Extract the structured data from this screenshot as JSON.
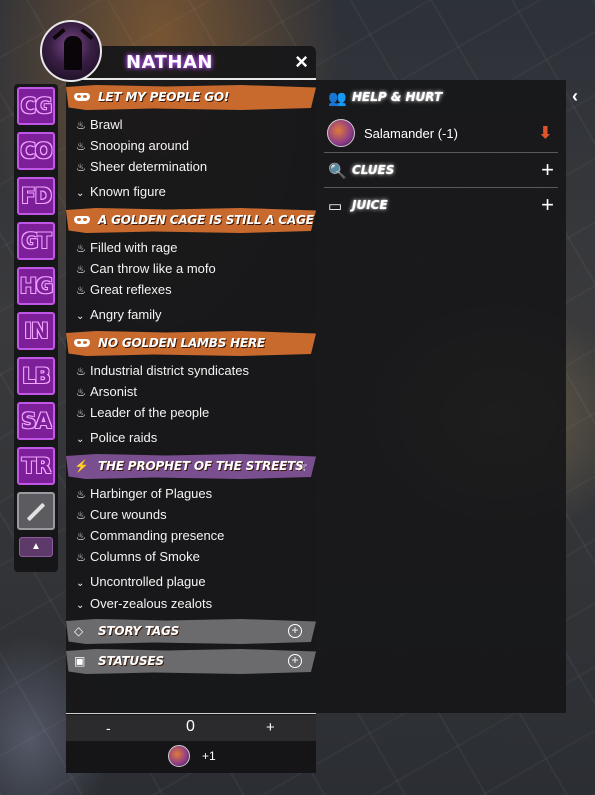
{
  "character": {
    "name": "NATHAN"
  },
  "side_tabs": [
    "CG",
    "CO",
    "FD",
    "GT",
    "HG",
    "IN",
    "LB",
    "SA",
    "TR"
  ],
  "themes": [
    {
      "title": "LET MY PEOPLE GO!",
      "color": "#c86a2e",
      "icon": "mask-icon",
      "power_tags": [
        "Brawl",
        "Snooping around",
        "Sheer determination"
      ],
      "weakness_tags": [
        "Known figure"
      ]
    },
    {
      "title": "A GOLDEN CAGE IS STILL A CAGE",
      "color": "#c86a2e",
      "icon": "mask-icon",
      "power_tags": [
        "Filled with rage",
        "Can throw like a mofo",
        "Great reflexes"
      ],
      "weakness_tags": [
        "Angry family"
      ]
    },
    {
      "title": "NO GOLDEN LAMBS HERE",
      "color": "#c86a2e",
      "icon": "mask-icon",
      "power_tags": [
        "Industrial district syndicates",
        "Arsonist",
        "Leader of the people"
      ],
      "weakness_tags": [
        "Police raids"
      ]
    },
    {
      "title": "THE PROPHET OF THE STREETS",
      "color": "#7a4f8f",
      "icon": "lightning-icon",
      "power_tags": [
        "Harbinger of Plagues",
        "Cure wounds",
        "Commanding presence",
        "Columns of Smoke"
      ],
      "weakness_tags": [
        "Uncontrolled plague",
        "Over-zealous zealots"
      ]
    }
  ],
  "sections": {
    "story_tags": "STORY TAGS",
    "statuses": "STATUSES"
  },
  "counter": {
    "minus": "-",
    "value": "0",
    "plus": "+",
    "modifier": "+1"
  },
  "right_panel": {
    "help_hurt_title": "HELP & HURT",
    "help_entries": [
      {
        "name": "Salamander (-1)"
      }
    ],
    "clues_title": "CLUES",
    "juice_title": "JUICE"
  },
  "icons": {
    "close": "×",
    "collapse": "‹",
    "star": "☆",
    "flame": "♨",
    "chevron": "⌄"
  }
}
